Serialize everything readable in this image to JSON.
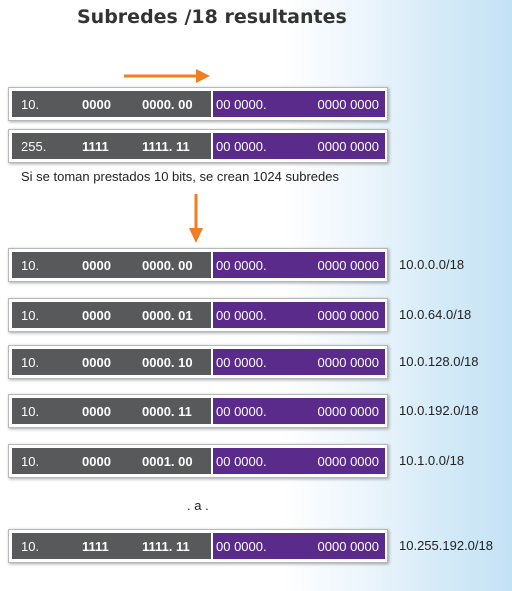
{
  "title": "Subredes /18 resultantes",
  "header_rows": [
    {
      "a": "10.",
      "b": "0000",
      "c": "0000. 00",
      "d": "00 0000.",
      "e": "0000 0000"
    },
    {
      "a": "255.",
      "b": "1111",
      "c": "1111. 11",
      "d": "00 0000.",
      "e": "0000 0000"
    }
  ],
  "note": "Si se toman prestados 10 bits, se crean 1024 subredes",
  "subnets": [
    {
      "a": "10.",
      "b": "0000",
      "c": "0000. 00",
      "d": "00 0000.",
      "e": "0000 0000",
      "label": "10.0.0.0/18"
    },
    {
      "a": "10.",
      "b": "0000",
      "c": "0000. 01",
      "d": "00 0000.",
      "e": "0000 0000",
      "label": "10.0.64.0/18"
    },
    {
      "a": "10.",
      "b": "0000",
      "c": "0000. 10",
      "d": "00 0000.",
      "e": "0000 0000",
      "label": "10.0.128.0/18"
    },
    {
      "a": "10.",
      "b": "0000",
      "c": "0000. 11",
      "d": "00 0000.",
      "e": "0000 0000",
      "label": "10.0.192.0/18"
    },
    {
      "a": "10.",
      "b": "0000",
      "c": "0001. 00",
      "d": "00 0000.",
      "e": "0000 0000",
      "label": "10.1.0.0/18"
    },
    {
      "a": "10.",
      "b": "1111",
      "c": "1111. 11",
      "d": "00 0000.",
      "e": "0000 0000",
      "label": "10.255.192.0/18"
    }
  ],
  "ellipsis": ". a .",
  "colors": {
    "network": "#58595b",
    "host": "#5b2b8c",
    "arrow": "#f07d22"
  }
}
